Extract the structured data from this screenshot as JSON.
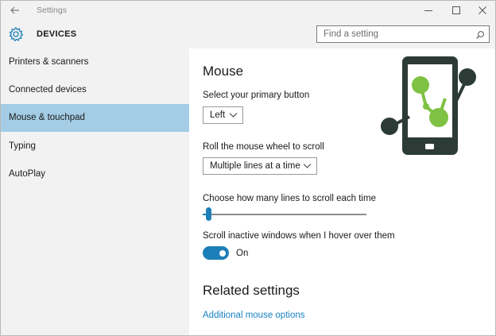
{
  "window": {
    "app_title": "Settings",
    "back_icon": "arrow-left-icon",
    "controls": [
      "minimize-icon",
      "maximize-icon",
      "close-icon"
    ]
  },
  "header": {
    "section_title": "DEVICES",
    "icon": "gear-icon",
    "search_placeholder": "Find a setting"
  },
  "sidebar": {
    "items": [
      {
        "label": "Printers & scanners",
        "active": false
      },
      {
        "label": "Connected devices",
        "active": false
      },
      {
        "label": "Mouse & touchpad",
        "active": true
      },
      {
        "label": "Typing",
        "active": false
      },
      {
        "label": "AutoPlay",
        "active": false
      }
    ]
  },
  "main": {
    "title": "Mouse",
    "primary_button": {
      "label": "Select your primary button",
      "value": "Left"
    },
    "scroll_wheel": {
      "label": "Roll the mouse wheel to scroll",
      "value": "Multiple lines at a time"
    },
    "lines_slider": {
      "label": "Choose how many lines to scroll each time",
      "value": 3,
      "min": 1,
      "max": 100
    },
    "inactive_scroll": {
      "label": "Scroll inactive windows when I hover over them",
      "state": "On"
    },
    "related_title": "Related settings",
    "related_link": "Additional mouse options"
  },
  "colors": {
    "accent": "#1e7fb8",
    "selected_nav": "#a4cde5",
    "chrome": "#f2f2f2",
    "link": "#1a82c4",
    "logo_dark": "#2d3b37",
    "logo_green": "#7fc142"
  },
  "logo_icon": "phone-molecule-logo-icon"
}
